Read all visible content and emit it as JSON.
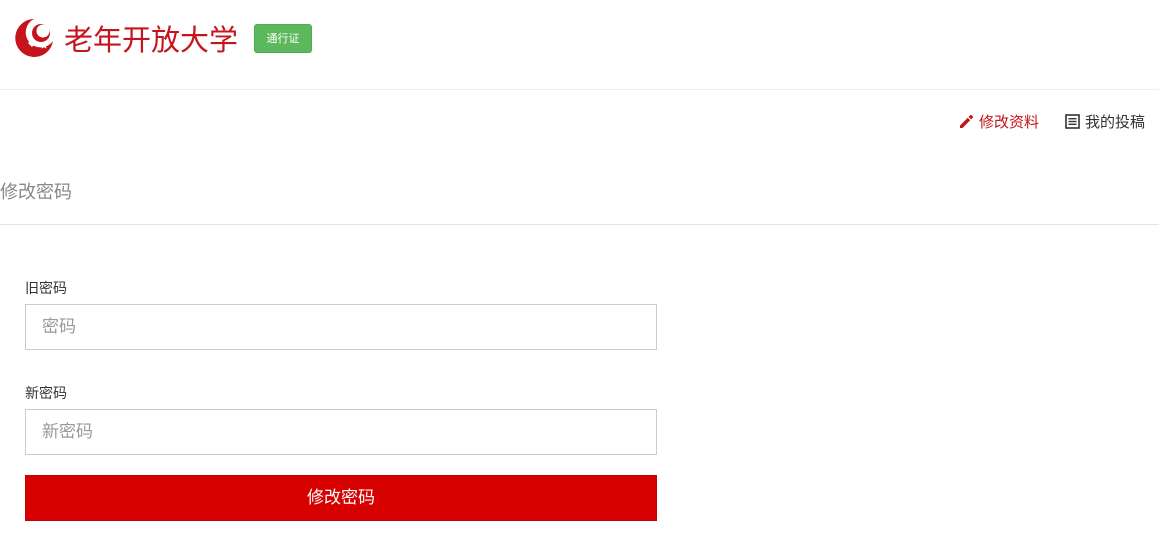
{
  "header": {
    "logo_icon": "crescent-logo-icon",
    "site_name": "老年开放大学",
    "pass_badge": "通行证",
    "colors": {
      "brand": "#c5141d",
      "badge": "#5cb85c"
    }
  },
  "nav": {
    "edit_profile": {
      "label": "修改资料",
      "icon": "pencil-icon"
    },
    "my_posts": {
      "label": "我的投稿",
      "icon": "list-icon"
    }
  },
  "page": {
    "section_title": "修改密码"
  },
  "form": {
    "old_password": {
      "label": "旧密码",
      "placeholder": "密码",
      "value": ""
    },
    "new_password": {
      "label": "新密码",
      "placeholder": "新密码",
      "value": ""
    },
    "submit_label": "修改密码",
    "submit_color": "#d60000"
  }
}
